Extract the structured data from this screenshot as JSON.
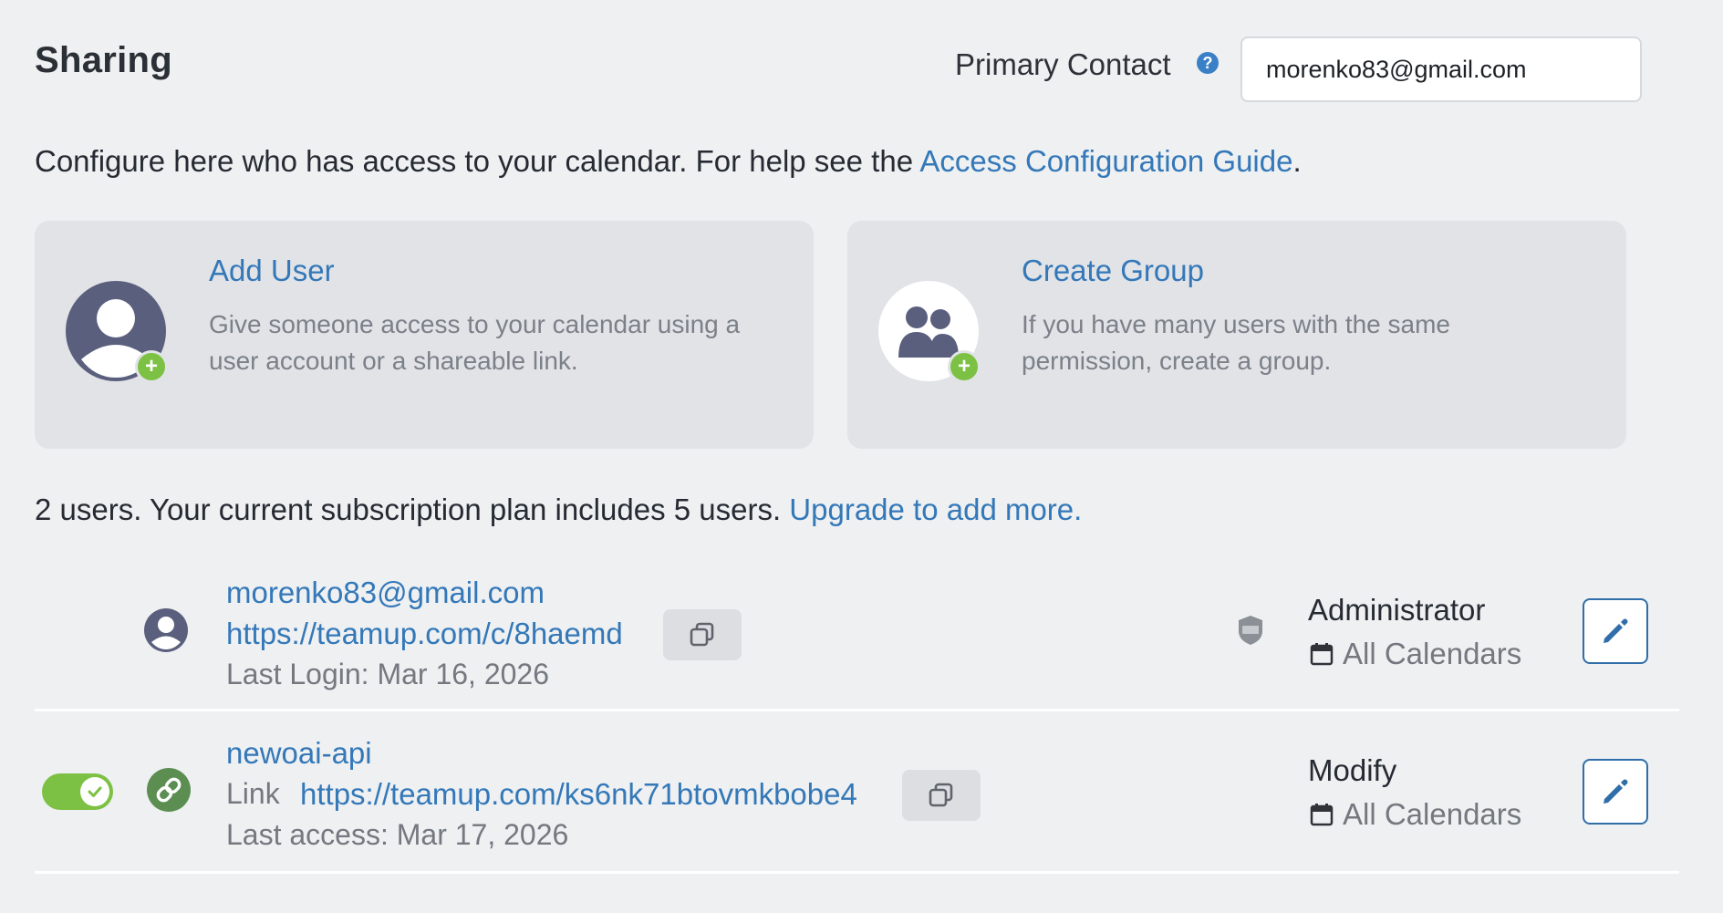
{
  "header": {
    "title": "Sharing",
    "primary_contact_label": "Primary Contact",
    "help_icon": "?",
    "primary_contact_value": "morenko83@gmail.com"
  },
  "intro": {
    "text": "Configure here who has access to your calendar. For help see the ",
    "link": "Access Configuration Guide",
    "end": "."
  },
  "cards": {
    "add_user": {
      "title": "Add User",
      "description": "Give someone access to your calendar using a user account or a shareable link.",
      "icon": "user-add-icon"
    },
    "create_group": {
      "title": "Create Group",
      "description": "If you have many users with the same permission, create a group.",
      "icon": "group-add-icon"
    }
  },
  "users_info": {
    "text": "2 users. Your current subscription plan includes 5 users. ",
    "link": "Upgrade to add more."
  },
  "users": [
    {
      "name": "morenko83@gmail.com",
      "url": "https://teamup.com/c/8haemd",
      "last": "Last Login: Mar 16, 2026",
      "role": "Administrator",
      "calendars": "All Calendars",
      "type_icon": "user-icon",
      "badge_icon": "2fa-shield-icon"
    },
    {
      "name": "newoai-api",
      "link_label": "Link",
      "url": "https://teamup.com/ks6nk71btovmkbobe4",
      "last": "Last access: Mar 17, 2026",
      "role": "Modify",
      "calendars": "All Calendars",
      "type_icon": "link-icon",
      "enabled": true
    }
  ],
  "colors": {
    "background": "#eef0f2",
    "card": "#e1e3e7",
    "link": "#3478b8",
    "accent_green": "#7cc143",
    "avatar": "#5a5f7d"
  }
}
